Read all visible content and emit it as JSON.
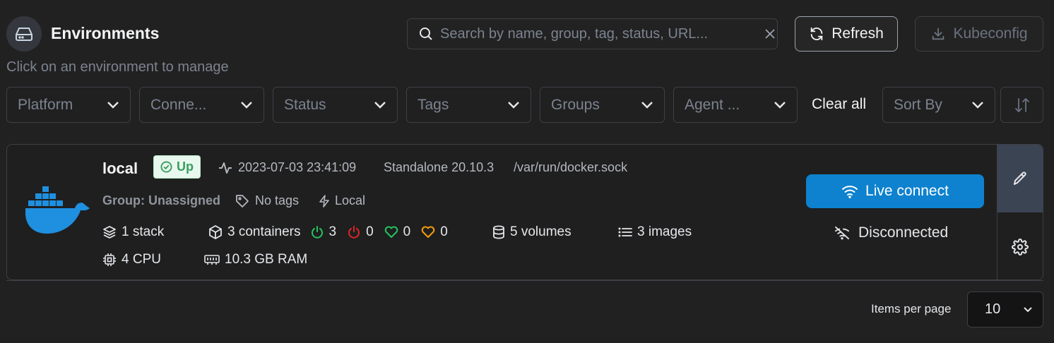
{
  "header": {
    "title": "Environments",
    "subtitle": "Click on an environment to manage",
    "search_placeholder": "Search by name, group, tag, status, URL...",
    "refresh_label": "Refresh",
    "kubeconfig_label": "Kubeconfig"
  },
  "filters": {
    "items": [
      "Platform",
      "Conne...",
      "Status",
      "Tags",
      "Groups",
      "Agent ..."
    ],
    "clear_all": "Clear all",
    "sort_by": "Sort By"
  },
  "environment": {
    "name": "local",
    "status": "Up",
    "heartbeat": "2023-07-03 23:41:09",
    "type": "Standalone 20.10.3",
    "url": "/var/run/docker.sock",
    "group": "Group: Unassigned",
    "tags": "No tags",
    "location": "Local",
    "stacks": "1 stack",
    "containers": "3 containers",
    "running": "3",
    "stopped": "0",
    "healthy": "0",
    "unhealthy": "0",
    "volumes": "5 volumes",
    "images": "3 images",
    "cpu": "4 CPU",
    "ram": "10.3 GB RAM",
    "live_connect": "Live connect",
    "connection_status": "Disconnected"
  },
  "pagination": {
    "items_per_page_label": "Items per page",
    "items_per_page_value": "10"
  },
  "colors": {
    "accent": "#0e82cf",
    "docker_blue": "#1f8fe0",
    "running": "#22c55e",
    "stopped": "#dc2626",
    "healthy": "#22c55e",
    "unhealthy": "#f59e0b"
  }
}
